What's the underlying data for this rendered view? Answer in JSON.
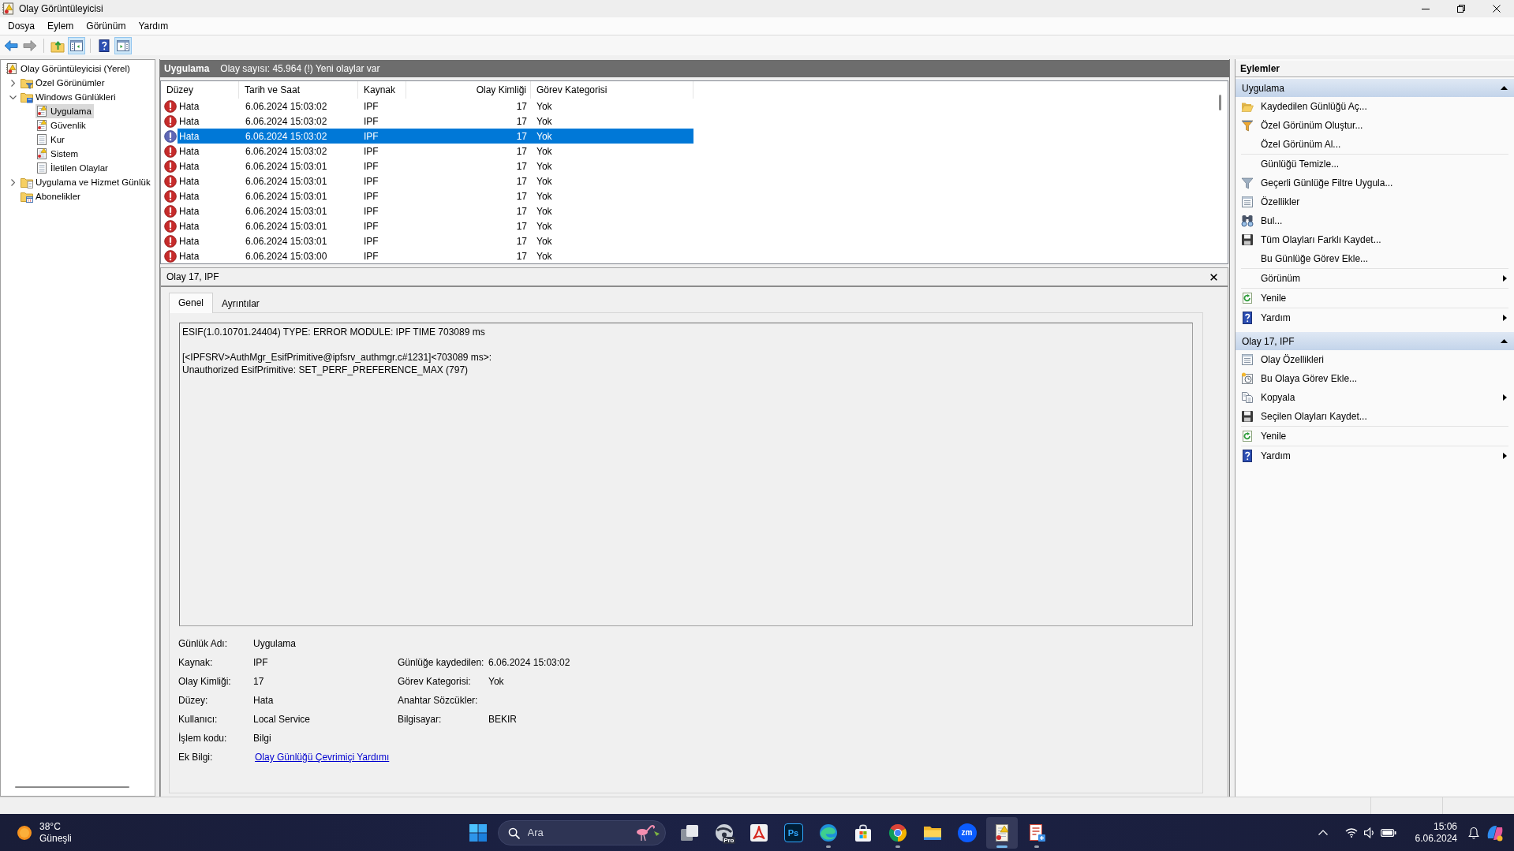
{
  "window": {
    "title": "Olay Görüntüleyicisi"
  },
  "menu": [
    "Dosya",
    "Eylem",
    "Görünüm",
    "Yardım"
  ],
  "toolbar": [
    [
      {
        "kind": "back",
        "pressed": false,
        "disabled": false
      },
      {
        "kind": "forward",
        "pressed": false,
        "disabled": true
      }
    ],
    [
      {
        "kind": "up",
        "pressed": false,
        "disabled": false
      },
      {
        "kind": "tree-pane",
        "pressed": true,
        "disabled": false
      }
    ],
    [
      {
        "kind": "help",
        "pressed": false,
        "disabled": false
      },
      {
        "kind": "action-pane",
        "pressed": true,
        "disabled": false
      }
    ]
  ],
  "tree": [
    {
      "label": "Olay Görüntüleyicisi (Yerel)",
      "kind": "viewer",
      "selected": false,
      "children": [
        {
          "label": "Özel Görünümler",
          "kind": "custom-views",
          "expanded": false,
          "selected": false
        },
        {
          "label": "Windows Günlükleri",
          "kind": "windows-logs",
          "expanded": true,
          "selected": false,
          "children": [
            {
              "label": "Uygulama",
              "kind": "log-warn",
              "selected": true
            },
            {
              "label": "Güvenlik",
              "kind": "log-warn",
              "selected": false
            },
            {
              "label": "Kur",
              "kind": "log-plain",
              "selected": false
            },
            {
              "label": "Sistem",
              "kind": "log-warn",
              "selected": false
            },
            {
              "label": "İletilen Olaylar",
              "kind": "log-plain",
              "selected": false
            }
          ]
        },
        {
          "label": "Uygulama ve Hizmet Günlük",
          "kind": "app-logs",
          "expanded": false,
          "selected": false
        },
        {
          "label": "Abonelikler",
          "kind": "subscriptions",
          "selected": false
        }
      ]
    }
  ],
  "event_list": {
    "title": "Uygulama",
    "summary": "Olay sayısı: 45.964 (!) Yeni olaylar var",
    "columns": [
      "Düzey",
      "Tarih ve Saat",
      "Kaynak",
      "Olay Kimliği",
      "Görev Kategorisi"
    ],
    "rows": [
      {
        "kind": "error",
        "selected": false,
        "cells": [
          "Hata",
          "6.06.2024 15:03:02",
          "IPF",
          "17",
          "Yok"
        ]
      },
      {
        "kind": "error",
        "selected": false,
        "cells": [
          "Hata",
          "6.06.2024 15:03:02",
          "IPF",
          "17",
          "Yok"
        ]
      },
      {
        "kind": "error",
        "selected": true,
        "cells": [
          "Hata",
          "6.06.2024 15:03:02",
          "IPF",
          "17",
          "Yok"
        ]
      },
      {
        "kind": "error",
        "selected": false,
        "cells": [
          "Hata",
          "6.06.2024 15:03:02",
          "IPF",
          "17",
          "Yok"
        ]
      },
      {
        "kind": "error",
        "selected": false,
        "cells": [
          "Hata",
          "6.06.2024 15:03:01",
          "IPF",
          "17",
          "Yok"
        ]
      },
      {
        "kind": "error",
        "selected": false,
        "cells": [
          "Hata",
          "6.06.2024 15:03:01",
          "IPF",
          "17",
          "Yok"
        ]
      },
      {
        "kind": "error",
        "selected": false,
        "cells": [
          "Hata",
          "6.06.2024 15:03:01",
          "IPF",
          "17",
          "Yok"
        ]
      },
      {
        "kind": "error",
        "selected": false,
        "cells": [
          "Hata",
          "6.06.2024 15:03:01",
          "IPF",
          "17",
          "Yok"
        ]
      },
      {
        "kind": "error",
        "selected": false,
        "cells": [
          "Hata",
          "6.06.2024 15:03:01",
          "IPF",
          "17",
          "Yok"
        ]
      },
      {
        "kind": "error",
        "selected": false,
        "cells": [
          "Hata",
          "6.06.2024 15:03:01",
          "IPF",
          "17",
          "Yok"
        ]
      },
      {
        "kind": "error",
        "selected": false,
        "cells": [
          "Hata",
          "6.06.2024 15:03:00",
          "IPF",
          "17",
          "Yok"
        ]
      }
    ]
  },
  "details": {
    "title": "Olay 17, IPF",
    "tabs": [
      {
        "label": "Genel",
        "selected": true
      },
      {
        "label": "Ayrıntılar",
        "selected": false
      }
    ],
    "message": [
      "ESIF(1.0.10701.24404) TYPE: ERROR MODULE: IPF TIME 703089 ms",
      "[<IPFSRV>AuthMgr_EsifPrimitive@ipfsrv_authmgr.c#1231]<703089 ms>:\nUnauthorized EsifPrimitive: SET_PERF_PREFERENCE_MAX (797)"
    ],
    "fields": [
      {
        "left": {
          "label": "Günlük Adı:",
          "value": "Uygulama"
        }
      },
      {
        "left": {
          "label": "Kaynak:",
          "value": "IPF"
        },
        "right": {
          "label": "Günlüğe kaydedilen:",
          "value": "6.06.2024 15:03:02"
        }
      },
      {
        "left": {
          "label": "Olay Kimliği:",
          "value": "17"
        },
        "right": {
          "label": "Görev Kategorisi:",
          "value": "Yok"
        }
      },
      {
        "left": {
          "label": "Düzey:",
          "value": "Hata"
        },
        "right": {
          "label": "Anahtar Sözcükler:"
        }
      },
      {
        "left": {
          "label": "Kullanıcı:",
          "value": "Local Service"
        },
        "right": {
          "label": "Bilgisayar:",
          "value": "BEKIR"
        }
      },
      {
        "left": {
          "label": "İşlem kodu:",
          "value": "Bilgi"
        }
      },
      {
        "left": {
          "label": "Ek Bilgi:",
          "link": "Olay Günlüğü Çevrimiçi Yardımı"
        }
      }
    ]
  },
  "actions": {
    "title": "Eylemler",
    "sections": [
      {
        "title": "Uygulama",
        "expanded": true,
        "groups": [
          {
            "items": [
              {
                "label": "Kaydedilen Günlüğü Aç...",
                "kind": "open-folder",
                "submenu": false
              },
              {
                "label": "Özel Görünüm Oluştur...",
                "kind": "filter-color",
                "submenu": false
              },
              {
                "label": "Özel Görünüm Al...",
                "kind": "plain",
                "submenu": false
              }
            ]
          },
          {
            "items": [
              {
                "label": "Günlüğü Temizle...",
                "kind": "plain",
                "submenu": false
              },
              {
                "label": "Geçerli Günlüğe Filtre Uygula...",
                "kind": "filter",
                "submenu": false
              },
              {
                "label": "Özellikler",
                "kind": "properties",
                "submenu": false
              },
              {
                "label": "Bul...",
                "kind": "binoculars",
                "submenu": false
              },
              {
                "label": "Tüm Olayları Farklı Kaydet...",
                "kind": "floppy",
                "submenu": false
              },
              {
                "label": "Bu Günlüğe Görev Ekle...",
                "kind": "plain",
                "submenu": false
              }
            ]
          },
          {
            "items": [
              {
                "label": "Görünüm",
                "kind": "plain",
                "submenu": true
              }
            ]
          },
          {
            "items": [
              {
                "label": "Yenile",
                "kind": "refresh",
                "submenu": false
              }
            ]
          },
          {
            "items": [
              {
                "label": "Yardım",
                "kind": "help",
                "submenu": true
              }
            ]
          }
        ]
      },
      {
        "title": "Olay 17, IPF",
        "expanded": true,
        "groups": [
          {
            "items": [
              {
                "label": "Olay Özellikleri",
                "kind": "properties",
                "submenu": false
              },
              {
                "label": "Bu Olaya Görev Ekle...",
                "kind": "task",
                "submenu": false
              },
              {
                "label": "Kopyala",
                "kind": "copy",
                "submenu": true
              },
              {
                "label": "Seçilen Olayları Kaydet...",
                "kind": "floppy",
                "submenu": false
              }
            ]
          },
          {
            "items": [
              {
                "label": "Yenile",
                "kind": "refresh",
                "submenu": false
              }
            ]
          },
          {
            "items": [
              {
                "label": "Yardım",
                "kind": "help",
                "submenu": true
              }
            ]
          }
        ]
      }
    ]
  },
  "taskbar": {
    "weather": {
      "temperature": "38°C",
      "condition": "Güneşli"
    },
    "search": {
      "placeholder": "Ara"
    },
    "apps": [
      {
        "kind": "stacked-windows",
        "active": false,
        "running": false
      },
      {
        "kind": "disc",
        "badge": "Pro",
        "active": false,
        "running": false
      },
      {
        "kind": "triangle-logo",
        "active": false,
        "running": false
      },
      {
        "kind": "square-tile",
        "glyph": "Ps",
        "active": false,
        "running": false
      },
      {
        "kind": "wave-logo",
        "active": false,
        "running": true
      },
      {
        "kind": "bag",
        "active": false,
        "running": false
      },
      {
        "kind": "tricolor-circle",
        "active": false,
        "running": true
      },
      {
        "kind": "folder",
        "active": false,
        "running": false
      },
      {
        "kind": "round-tile",
        "glyph": "zm",
        "active": false,
        "running": false
      },
      {
        "kind": "log-viewer",
        "active": true,
        "running": true
      },
      {
        "kind": "document",
        "active": false,
        "running": true
      }
    ],
    "clock": {
      "time": "15:06",
      "date": "6.06.2024"
    }
  }
}
